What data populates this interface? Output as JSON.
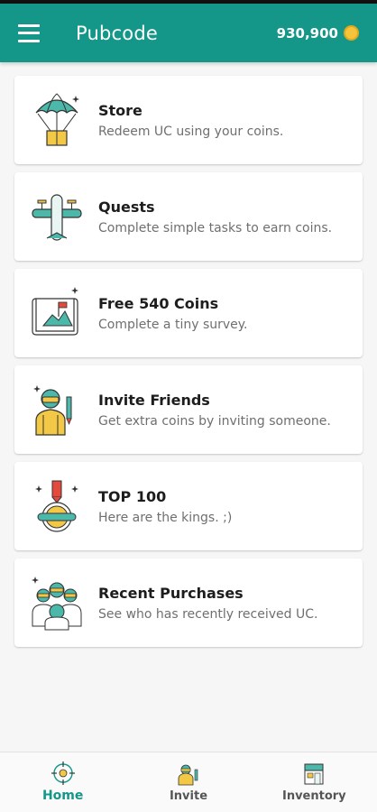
{
  "appbar": {
    "title": "Pubcode",
    "coins": "930,900"
  },
  "colors": {
    "primary": "#149688",
    "coin": "#f5c43a"
  },
  "cards": [
    {
      "title": "Store",
      "subtitle": "Redeem UC using your coins.",
      "icon": "parachute-crate-icon"
    },
    {
      "title": "Quests",
      "subtitle": "Complete simple tasks to earn coins.",
      "icon": "airplane-icon"
    },
    {
      "title": "Free 540 Coins",
      "subtitle": "Complete a tiny survey.",
      "icon": "map-flag-icon"
    },
    {
      "title": "Invite Friends",
      "subtitle": "Get extra coins by inviting someone.",
      "icon": "soldier-icon"
    },
    {
      "title": "TOP 100",
      "subtitle": "Here are the kings. ;)",
      "icon": "medal-icon"
    },
    {
      "title": "Recent Purchases",
      "subtitle": "See who has recently received UC.",
      "icon": "squad-icon"
    }
  ],
  "bottomnav": {
    "items": [
      {
        "label": "Home",
        "icon": "crosshair-icon",
        "active": true
      },
      {
        "label": "Invite",
        "icon": "soldier-icon"
      },
      {
        "label": "Inventory",
        "icon": "shop-icon"
      }
    ]
  }
}
